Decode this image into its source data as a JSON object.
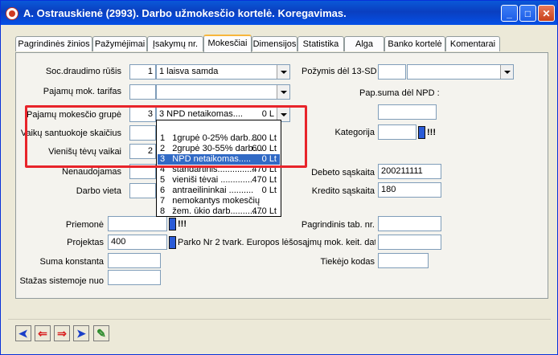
{
  "window": {
    "title": "A. Ostrauskienė  (2993).  Darbo užmokesčio kortelė. Koregavimas.",
    "minimize_glyph": "_",
    "maximize_glyph": "□",
    "close_glyph": "✕"
  },
  "tabs": [
    {
      "label": "Pagrindinės žinios"
    },
    {
      "label": "Pažymėjimai"
    },
    {
      "label": "Įsakymų nr."
    },
    {
      "label": "Mokesčiai"
    },
    {
      "label": "Dimensijos"
    },
    {
      "label": "Statistika"
    },
    {
      "label": "Alga"
    },
    {
      "label": "Banko kortelė"
    },
    {
      "label": "Komentarai"
    }
  ],
  "form": {
    "soc_draudimo_rusis": {
      "label": "Soc.draudimo rūšis",
      "code": "1",
      "value": "1    laisva samda"
    },
    "pajamu_mok_tarifas": {
      "label": "Pajamų mok. tarifas",
      "code": "",
      "value": ""
    },
    "pajamu_mokescio_grupe": {
      "label": "Pajamų mokesčio grupė",
      "code": "3",
      "value": "3   NPD netaikomas....",
      "amount": "0 L"
    },
    "vaiku_santuokoje_skaicius": {
      "label": "Vaikų santuokoje skaičius",
      "value": ""
    },
    "vienisu_tevu_vaikai": {
      "label": "Vienišų tėvų vaikai",
      "value": "2"
    },
    "nenaudojamas": {
      "label": "Nenaudojamas",
      "value": ""
    },
    "darbo_vieta": {
      "label": "Darbo vieta",
      "value": ""
    },
    "pozymis_13sd": {
      "label": "Požymis dėl 13-SD",
      "code": "",
      "value": ""
    },
    "pap_suma_npd": {
      "label": "Pap.suma dėl NPD :",
      "value": ""
    },
    "kategorija": {
      "label": "Kategorija",
      "value": "",
      "mark": "!!!"
    },
    "debeto_saskaita": {
      "label": "Debeto sąskaita",
      "value": "200211111"
    },
    "kredito_saskaita": {
      "label": "Kredito sąskaita",
      "value": "180"
    },
    "priemone": {
      "label": "Priemonė",
      "value": "",
      "mark": "!!!"
    },
    "projektas": {
      "label": "Projektas",
      "value": "400",
      "description": "Parko Nr 2 tvark. Europos lėšosąjmų mok. keit. data"
    },
    "suma_konstanta": {
      "label": "Suma konstanta",
      "value": ""
    },
    "stazas_sistemoje_nuo": {
      "label": "Stažas sistemoje nuo",
      "value": ""
    },
    "pagrindinis_tab_nr": {
      "label": "Pagrindinis tab. nr.",
      "value": ""
    },
    "tiekejo_kodas": {
      "label": "Tiekėjo kodas",
      "value": ""
    }
  },
  "dropdown_options": [
    {
      "num": "1",
      "text": "1grupė 0-25% darb.....",
      "amount": "800 Lt"
    },
    {
      "num": "2",
      "text": "2grupė 30-55% darb....",
      "amount": "600 Lt"
    },
    {
      "num": "3",
      "text": "NPD netaikomas.....",
      "amount": "0 Lt",
      "selected": true
    },
    {
      "num": "4",
      "text": "standartinis...............",
      "amount": "470 Lt"
    },
    {
      "num": "5",
      "text": "vieniši tėvai .............",
      "amount": "470 Lt"
    },
    {
      "num": "6",
      "text": "antraeilininkai ..........",
      "amount": "0 Lt"
    },
    {
      "num": "7",
      "text": "nemokantys mokesčių",
      "amount": ""
    },
    {
      "num": "8",
      "text": "žem. ūkio darb.............",
      "amount": "470 Lt"
    }
  ],
  "toolbar": {
    "first_glyph": "➤",
    "prev_glyph": "⇐",
    "next_glyph": "⇒",
    "last_glyph": "➤",
    "extra_glyph": "✎"
  },
  "colors": {
    "titlebar": "#0a3fc0",
    "highlight": "#e8242a",
    "selection": "#316ac5",
    "active_tab_accent": "#f7b63c"
  }
}
